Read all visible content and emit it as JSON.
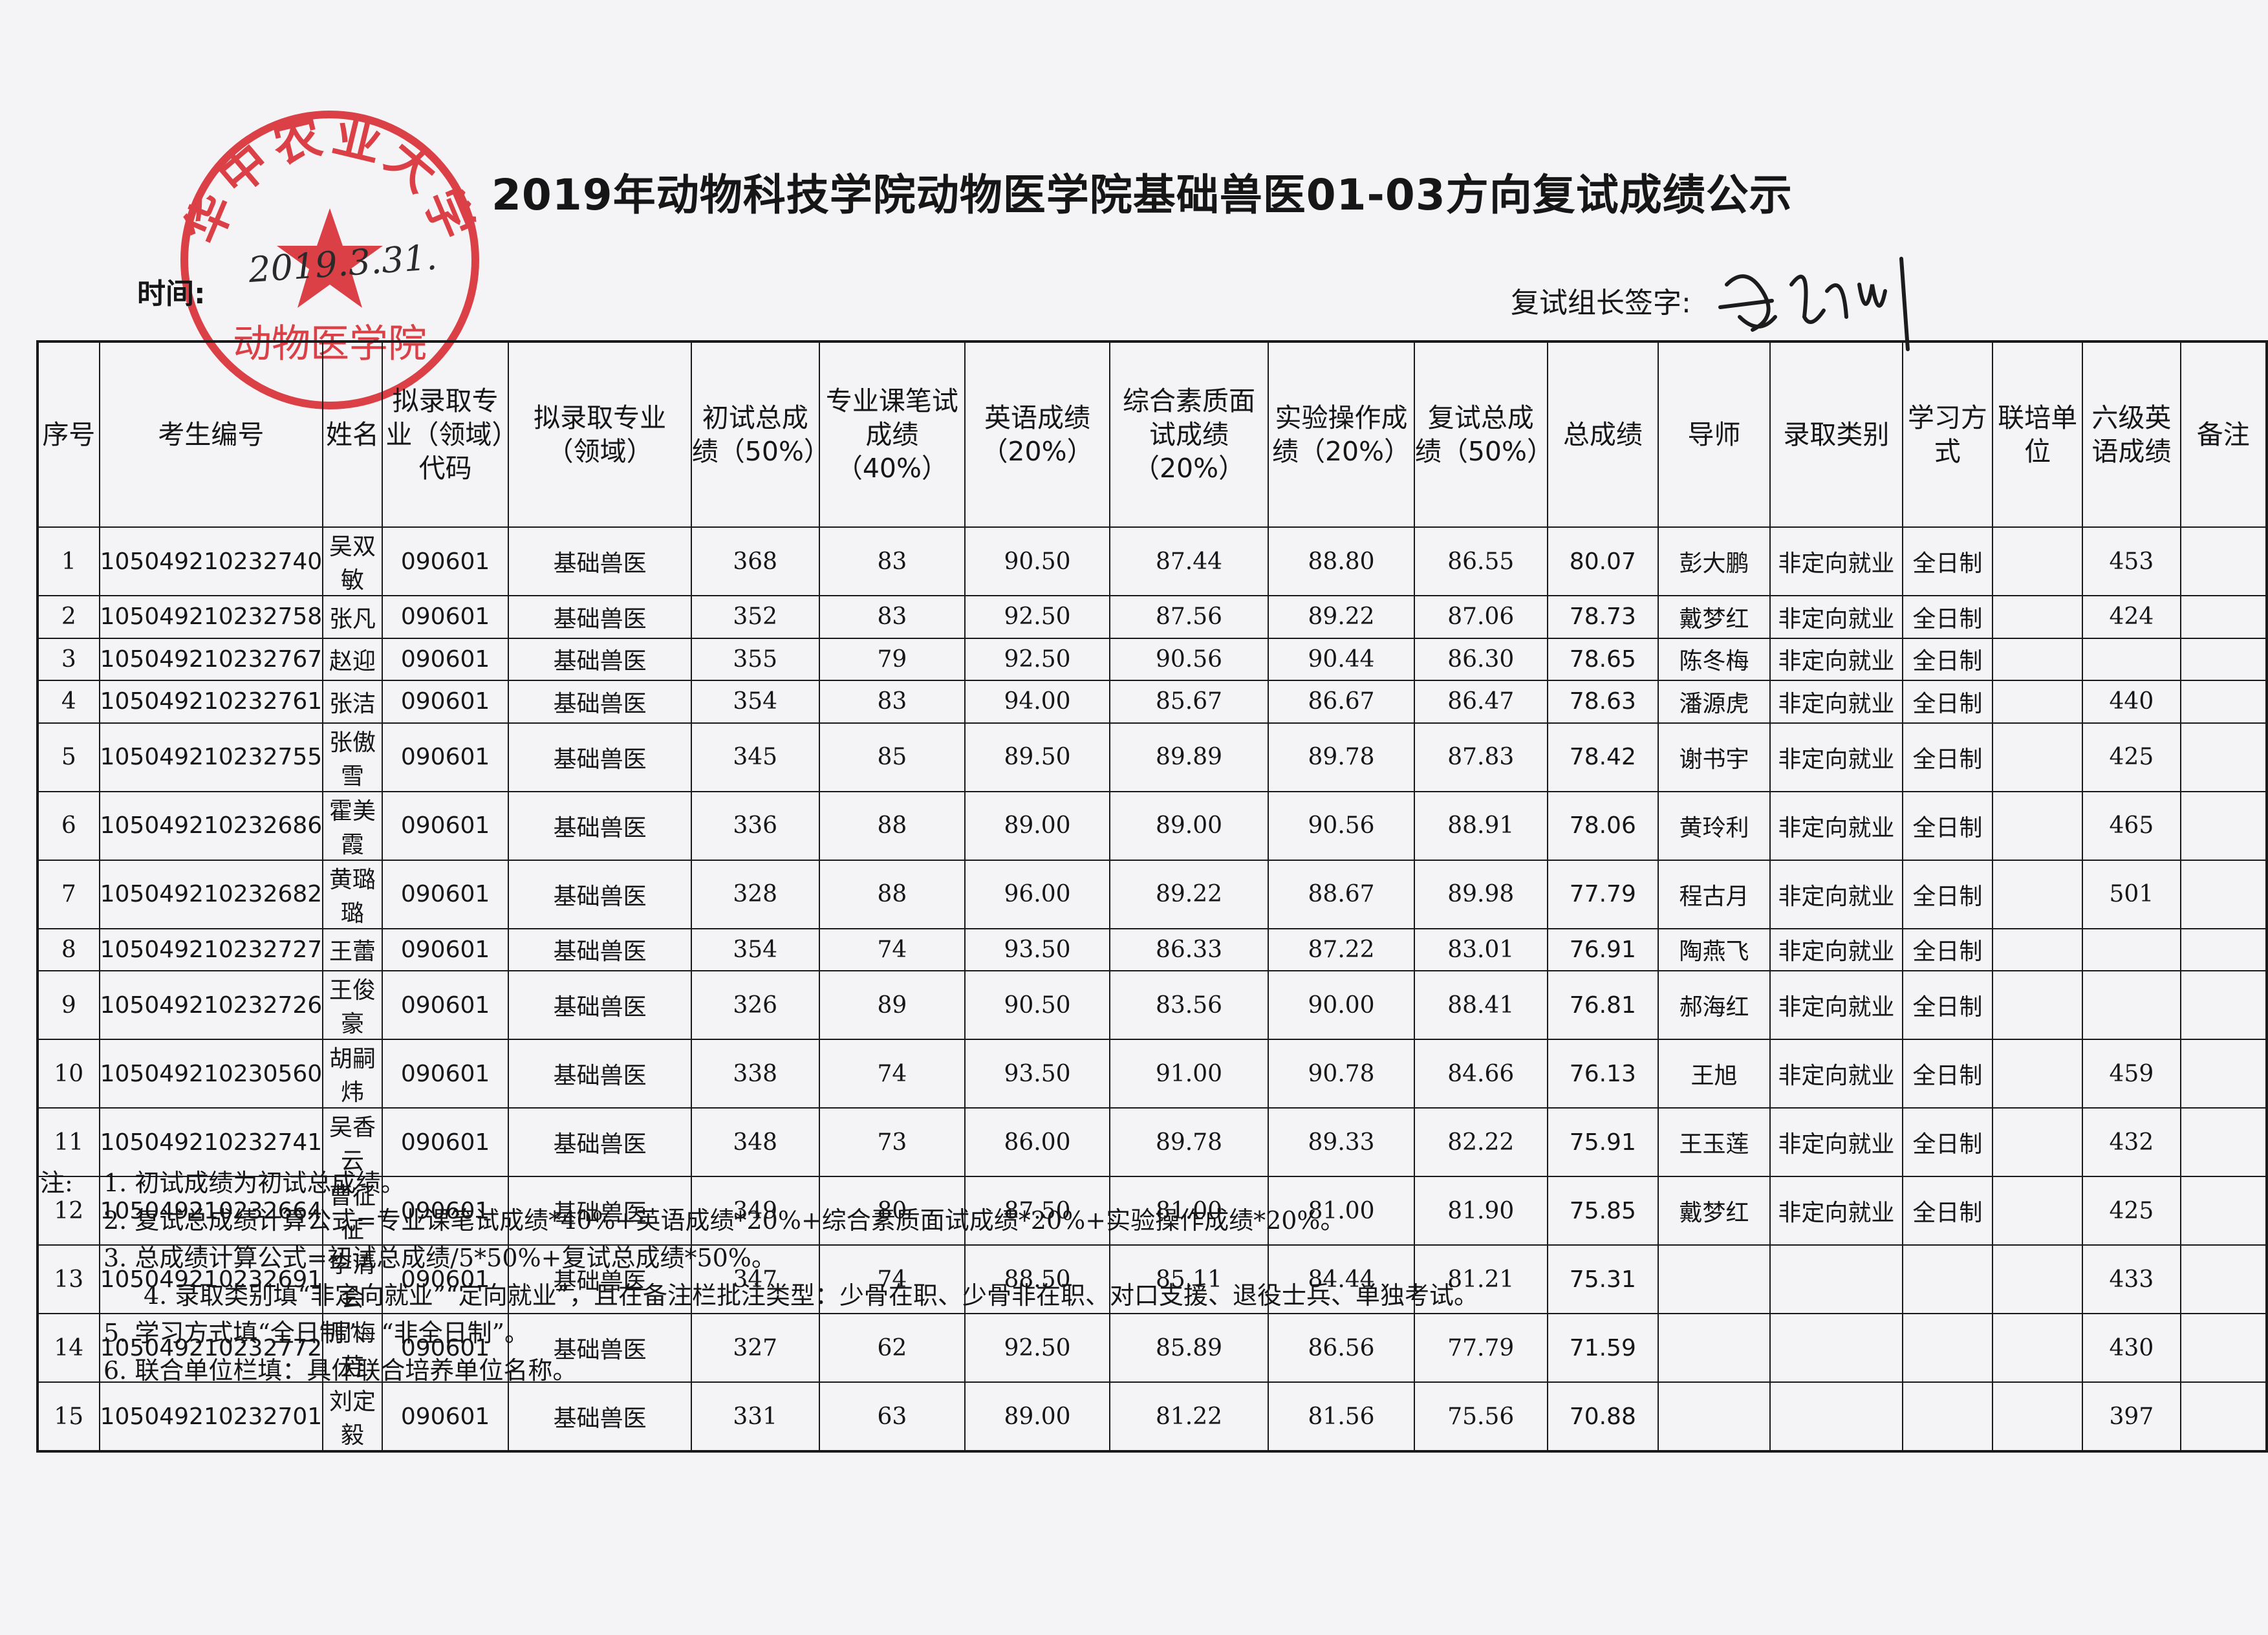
{
  "title": "2019年动物科技学院动物医学院基础兽医01-03方向复试成绩公示",
  "time_label": "时间:",
  "time_value": "2019.3.31.",
  "signer_label": "复试组长签字:",
  "seal": {
    "top_text": "华中农业大学",
    "bottom_text": "动物医学院",
    "color": "#d8282f",
    "icon": "star-icon"
  },
  "table": {
    "headers": [
      "序号",
      "考生编号",
      "姓名",
      "拟录取专业（领域）代码",
      "拟录取专业（领域）",
      "初试总成绩（50%）",
      "专业课笔试成绩（40%）",
      "英语成绩（20%）",
      "综合素质面试成绩（20%）",
      "实验操作成绩（20%）",
      "复试总成绩（50%）",
      "总成绩",
      "导师",
      "录取类别",
      "学习方式",
      "联培单位",
      "六级英语成绩",
      "备注"
    ],
    "rows": [
      [
        "1",
        "105049210232740",
        "吴双敏",
        "090601",
        "基础兽医",
        "368",
        "83",
        "90.50",
        "87.44",
        "88.80",
        "86.55",
        "80.07",
        "彭大鹏",
        "非定向就业",
        "全日制",
        "",
        "453",
        ""
      ],
      [
        "2",
        "105049210232758",
        "张凡",
        "090601",
        "基础兽医",
        "352",
        "83",
        "92.50",
        "87.56",
        "89.22",
        "87.06",
        "78.73",
        "戴梦红",
        "非定向就业",
        "全日制",
        "",
        "424",
        ""
      ],
      [
        "3",
        "105049210232767",
        "赵迎",
        "090601",
        "基础兽医",
        "355",
        "79",
        "92.50",
        "90.56",
        "90.44",
        "86.30",
        "78.65",
        "陈冬梅",
        "非定向就业",
        "全日制",
        "",
        "",
        ""
      ],
      [
        "4",
        "105049210232761",
        "张洁",
        "090601",
        "基础兽医",
        "354",
        "83",
        "94.00",
        "85.67",
        "86.67",
        "86.47",
        "78.63",
        "潘源虎",
        "非定向就业",
        "全日制",
        "",
        "440",
        ""
      ],
      [
        "5",
        "105049210232755",
        "张傲雪",
        "090601",
        "基础兽医",
        "345",
        "85",
        "89.50",
        "89.89",
        "89.78",
        "87.83",
        "78.42",
        "谢书宇",
        "非定向就业",
        "全日制",
        "",
        "425",
        ""
      ],
      [
        "6",
        "105049210232686",
        "霍美霞",
        "090601",
        "基础兽医",
        "336",
        "88",
        "89.00",
        "89.00",
        "90.56",
        "88.91",
        "78.06",
        "黄玲利",
        "非定向就业",
        "全日制",
        "",
        "465",
        ""
      ],
      [
        "7",
        "105049210232682",
        "黄璐璐",
        "090601",
        "基础兽医",
        "328",
        "88",
        "96.00",
        "89.22",
        "88.67",
        "89.98",
        "77.79",
        "程古月",
        "非定向就业",
        "全日制",
        "",
        "501",
        ""
      ],
      [
        "8",
        "105049210232727",
        "王蕾",
        "090601",
        "基础兽医",
        "354",
        "74",
        "93.50",
        "86.33",
        "87.22",
        "83.01",
        "76.91",
        "陶燕飞",
        "非定向就业",
        "全日制",
        "",
        "",
        ""
      ],
      [
        "9",
        "105049210232726",
        "王俊豪",
        "090601",
        "基础兽医",
        "326",
        "89",
        "90.50",
        "83.56",
        "90.00",
        "88.41",
        "76.81",
        "郝海红",
        "非定向就业",
        "全日制",
        "",
        "",
        ""
      ],
      [
        "10",
        "105049210230560",
        "胡嗣炜",
        "090601",
        "基础兽医",
        "338",
        "74",
        "93.50",
        "91.00",
        "90.78",
        "84.66",
        "76.13",
        "王旭",
        "非定向就业",
        "全日制",
        "",
        "459",
        ""
      ],
      [
        "11",
        "105049210232741",
        "吴香云",
        "090601",
        "基础兽医",
        "348",
        "73",
        "86.00",
        "89.78",
        "89.33",
        "82.22",
        "75.91",
        "王玉莲",
        "非定向就业",
        "全日制",
        "",
        "432",
        ""
      ],
      [
        "12",
        "105049210232664",
        "曹征征",
        "090601",
        "基础兽医",
        "349",
        "80",
        "87.50",
        "81.00",
        "81.00",
        "81.90",
        "75.85",
        "戴梦红",
        "非定向就业",
        "全日制",
        "",
        "425",
        ""
      ],
      [
        "13",
        "105049210232691",
        "李清会",
        "090601",
        "基础兽医",
        "347",
        "74",
        "88.50",
        "85.11",
        "84.44",
        "81.21",
        "75.31",
        "",
        "",
        "",
        "",
        "433",
        ""
      ],
      [
        "14",
        "105049210232772",
        "周梅芳",
        "090601",
        "基础兽医",
        "327",
        "62",
        "92.50",
        "85.89",
        "86.56",
        "77.79",
        "71.59",
        "",
        "",
        "",
        "",
        "430",
        ""
      ],
      [
        "15",
        "105049210232701",
        "刘定毅",
        "090601",
        "基础兽医",
        "331",
        "63",
        "89.00",
        "81.22",
        "81.56",
        "75.56",
        "70.88",
        "",
        "",
        "",
        "",
        "397",
        ""
      ]
    ]
  },
  "notes": {
    "prefix": "注:",
    "items": [
      "1. 初试成绩为初试总成绩。",
      "2. 复试总成绩计算公式=专业课笔试成绩*40%+英语成绩*20%+综合素质面试成绩*20%+实验操作成绩*20%。",
      "3. 总成绩计算公式=初试总成绩/5*50%+复试总成绩*50%。",
      "4. 录取类别填“非定向就业”“定向就业”，且在备注栏批注类型：少骨在职、少骨非在职、对口支援、退役士兵、单独考试。",
      "5. 学习方式填“全日制”、“非全日制”。",
      "6. 联合单位栏填：具体联合培养单位名称。"
    ]
  }
}
